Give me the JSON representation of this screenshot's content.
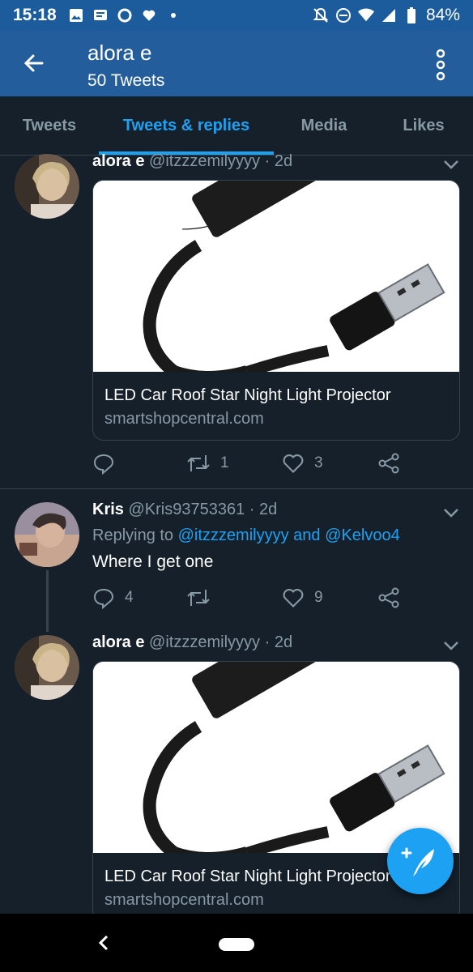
{
  "status_bar": {
    "time": "15:18",
    "battery": "84%",
    "icons": [
      "gallery-icon",
      "message-icon",
      "sync-icon",
      "heart-icon",
      "dot-icon",
      "bell-off-icon",
      "do-not-disturb-icon",
      "wifi-icon",
      "signal-icon",
      "battery-icon"
    ]
  },
  "header": {
    "title": "alora e",
    "subtitle": "50 Tweets"
  },
  "tabs": [
    {
      "label": "Tweets",
      "active": false
    },
    {
      "label": "Tweets & replies",
      "active": true
    },
    {
      "label": "Media",
      "active": false
    },
    {
      "label": "Likes",
      "active": false
    }
  ],
  "tweets": [
    {
      "name": "alora e",
      "handle": "@itzzzemilyyyy",
      "time": "2d",
      "card": {
        "title": "LED Car Roof Star Night Light Projector",
        "domain": "smartshopcentral.com"
      },
      "replies": "",
      "retweets": "1",
      "likes": "3"
    },
    {
      "name": "Kris",
      "handle": "@Kris93753361",
      "time": "2d",
      "replying_label": "Replying to",
      "reply_link_1": "@itzzzemilyyyy",
      "reply_and": "and",
      "reply_link_2": "@Kelvoo4",
      "text": "Where I get one",
      "replies": "4",
      "retweets": "",
      "likes": "9"
    },
    {
      "name": "alora e",
      "handle": "@itzzzemilyyyy",
      "time": "2d",
      "card": {
        "title": "LED Car Roof Star Night Light Projector",
        "domain": "smartshopcentral.com"
      }
    }
  ],
  "colors": {
    "accent": "#1da1f2",
    "background": "#15202b",
    "header": "#245d9c",
    "muted": "#8899a6"
  }
}
